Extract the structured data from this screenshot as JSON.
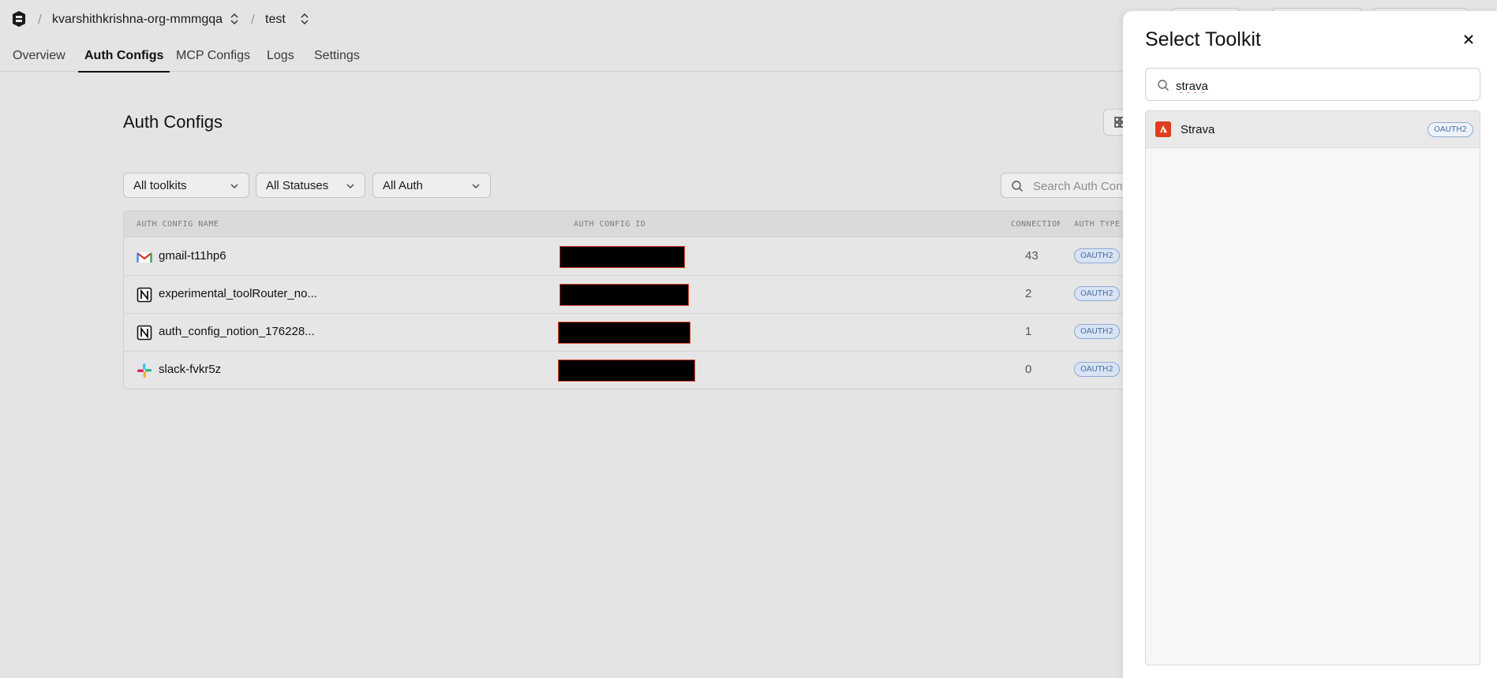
{
  "header": {
    "org": "kvarshithkrishna-org-mmmgqa",
    "project": "test",
    "separator": "/"
  },
  "tabs": [
    {
      "label": "Overview"
    },
    {
      "label": "Auth Configs",
      "active": true
    },
    {
      "label": "MCP Configs"
    },
    {
      "label": "Logs"
    },
    {
      "label": "Settings"
    }
  ],
  "main": {
    "title": "Auth Configs",
    "filters": {
      "toolkits": "All toolkits",
      "statuses": "All Statuses",
      "auth": "All Auth"
    },
    "search_placeholder": "Search Auth Configs"
  },
  "table": {
    "columns": [
      "AUTH CONFIG NAME",
      "AUTH CONFIG ID",
      "CONNECTIONS",
      "AUTH TYPE"
    ],
    "rows": [
      {
        "name": "gmail-t11hp6",
        "icon": "gmail-icon",
        "connections": "43",
        "auth_type": "OAUTH2"
      },
      {
        "name": "experimental_toolRouter_no...",
        "icon": "notion-icon",
        "connections": "2",
        "auth_type": "OAUTH2"
      },
      {
        "name": "auth_config_notion_176228...",
        "icon": "notion-icon",
        "connections": "1",
        "auth_type": "OAUTH2"
      },
      {
        "name": "slack-fvkr5z",
        "icon": "slack-icon",
        "connections": "0",
        "auth_type": "OAUTH2"
      }
    ]
  },
  "panel": {
    "title": "Select Toolkit",
    "search_value": "strava",
    "results": [
      {
        "name": "Strava",
        "icon": "strava-icon",
        "auth_type": "OAUTH2"
      }
    ]
  },
  "colors": {
    "background": "#e4e4e4",
    "panel": "#ffffff",
    "badge_text": "#4a6fa5",
    "strava": "#e03d20"
  }
}
